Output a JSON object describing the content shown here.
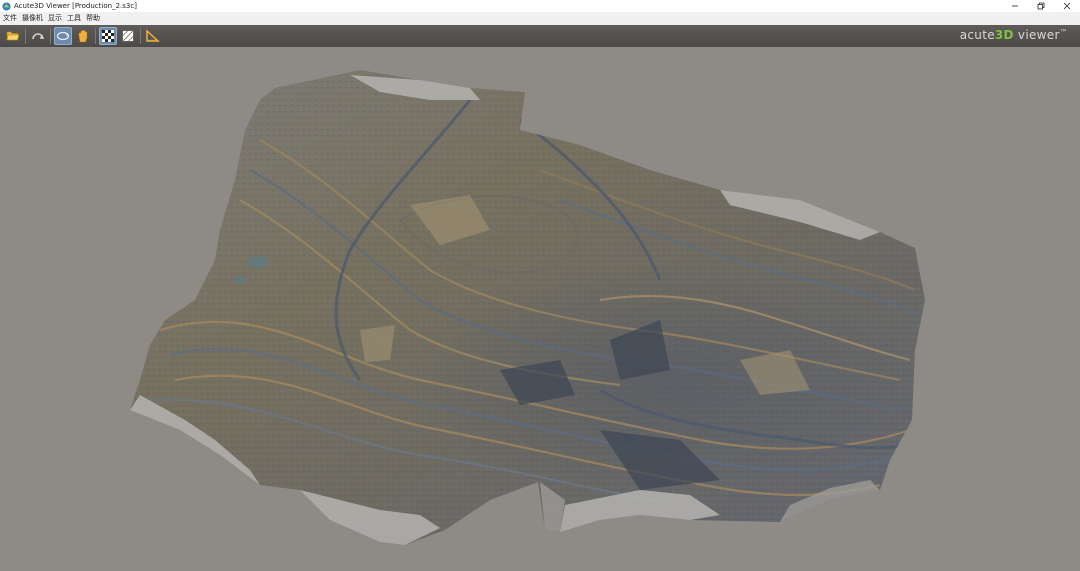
{
  "window": {
    "title": "Acute3D Viewer [Production_2.s3c]"
  },
  "menu": {
    "items": [
      {
        "label": "文件"
      },
      {
        "label": "摄像机"
      },
      {
        "label": "显示"
      },
      {
        "label": "工具"
      },
      {
        "label": "帮助"
      }
    ]
  },
  "toolbar": {
    "buttons": [
      {
        "icon": "open-folder-icon",
        "active": false
      },
      {
        "icon": "home-view-icon",
        "active": false
      },
      {
        "icon": "orbit-icon",
        "active": true
      },
      {
        "icon": "pan-hand-icon",
        "active": false
      },
      {
        "icon": "texture-checker-icon",
        "active": true
      },
      {
        "icon": "wireframe-icon",
        "active": false
      },
      {
        "icon": "measure-ruler-icon",
        "active": false
      }
    ]
  },
  "brand": {
    "part1": "acute",
    "part2": "3D",
    "part3": " viewer",
    "tm": "™",
    "accent_color": "#7cc242"
  },
  "viewport": {
    "background_color": "#8e8a86",
    "content": "3D textured mesh of open-pit mine terrain"
  }
}
